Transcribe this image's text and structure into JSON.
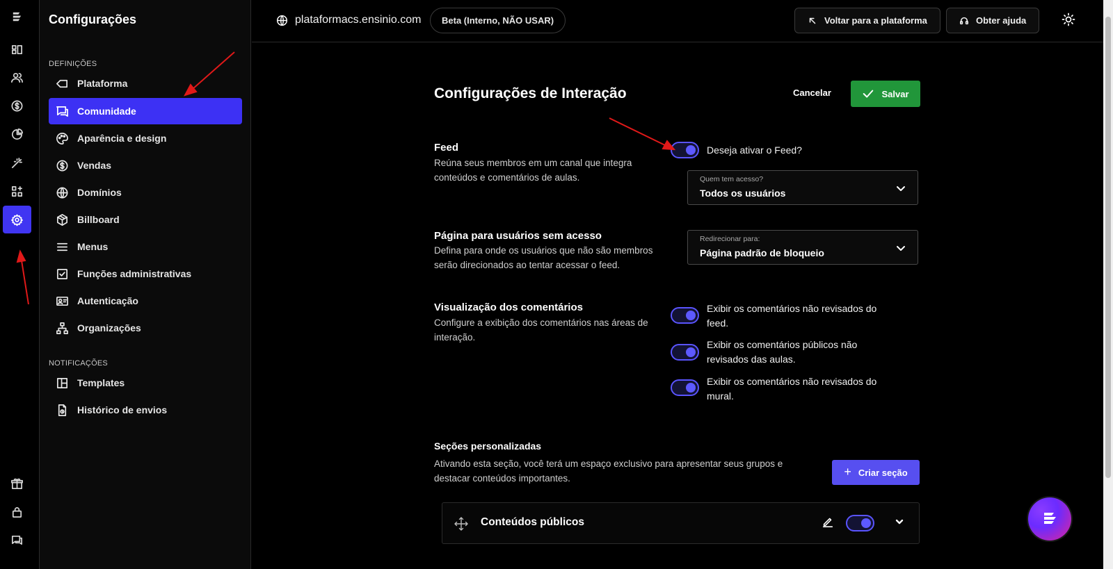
{
  "sidebar": {
    "title": "Configurações",
    "section_definitions": "DEFINIÇÕES",
    "section_notifications": "NOTIFICAÇÕES",
    "items": [
      {
        "label": "Plataforma",
        "icon": "tag-icon"
      },
      {
        "label": "Comunidade",
        "icon": "chat-icon",
        "active": true
      },
      {
        "label": "Aparência e design",
        "icon": "palette-icon"
      },
      {
        "label": "Vendas",
        "icon": "dollar-icon"
      },
      {
        "label": "Domínios",
        "icon": "globe-icon"
      },
      {
        "label": "Billboard",
        "icon": "box-icon"
      },
      {
        "label": "Menus",
        "icon": "menu-icon"
      },
      {
        "label": "Funções administrativas",
        "icon": "checkbox-icon"
      },
      {
        "label": "Autenticação",
        "icon": "id-card-icon"
      },
      {
        "label": "Organizações",
        "icon": "org-chart-icon"
      }
    ],
    "notification_items": [
      {
        "label": "Templates",
        "icon": "layout-icon"
      },
      {
        "label": "Histórico de envios",
        "icon": "file-clock-icon"
      }
    ]
  },
  "topbar": {
    "domain": "plataformacs.ensinio.com",
    "beta_badge": "Beta (Interno, NÃO USAR)",
    "back_button": "Voltar para a plataforma",
    "help_button": "Obter ajuda"
  },
  "main": {
    "title": "Configurações de Interação",
    "cancel": "Cancelar",
    "save": "Salvar",
    "feed": {
      "title": "Feed",
      "description": "Reúna seus membros em um canal que integra conteúdos e comentários de aulas.",
      "toggle_label": "Deseja ativar o Feed?",
      "toggle_on": true,
      "select_label": "Quem tem acesso?",
      "select_value": "Todos os usuários"
    },
    "no_access": {
      "title": "Página para usuários sem acesso",
      "description": "Defina para onde os usuários que não são membros serão direcionados ao tentar acessar o feed.",
      "select_label": "Redirecionar para:",
      "select_value": "Página padrão de bloqueio"
    },
    "comments": {
      "title": "Visualização dos comentários",
      "description": "Configure a exibição dos comentários nas áreas de interação.",
      "options": [
        {
          "label": "Exibir os comentários não revisados do feed.",
          "on": true
        },
        {
          "label": "Exibir os comentários públicos não revisados das aulas.",
          "on": true
        },
        {
          "label": "Exibir os comentários não revisados do mural.",
          "on": true
        }
      ]
    },
    "custom_sections": {
      "title": "Seções personalizadas",
      "description": "Ativando esta seção, você terá um espaço exclusivo para apresentar seus grupos e destacar conteúdos importantes.",
      "create_button": "Criar seção",
      "cards": [
        {
          "title": "Conteúdos públicos",
          "on": true
        }
      ]
    }
  },
  "colors": {
    "accent": "#3d31f4",
    "save_green": "#21963a",
    "toggle": "#5a54ff",
    "annotation_arrow": "#e01919"
  }
}
